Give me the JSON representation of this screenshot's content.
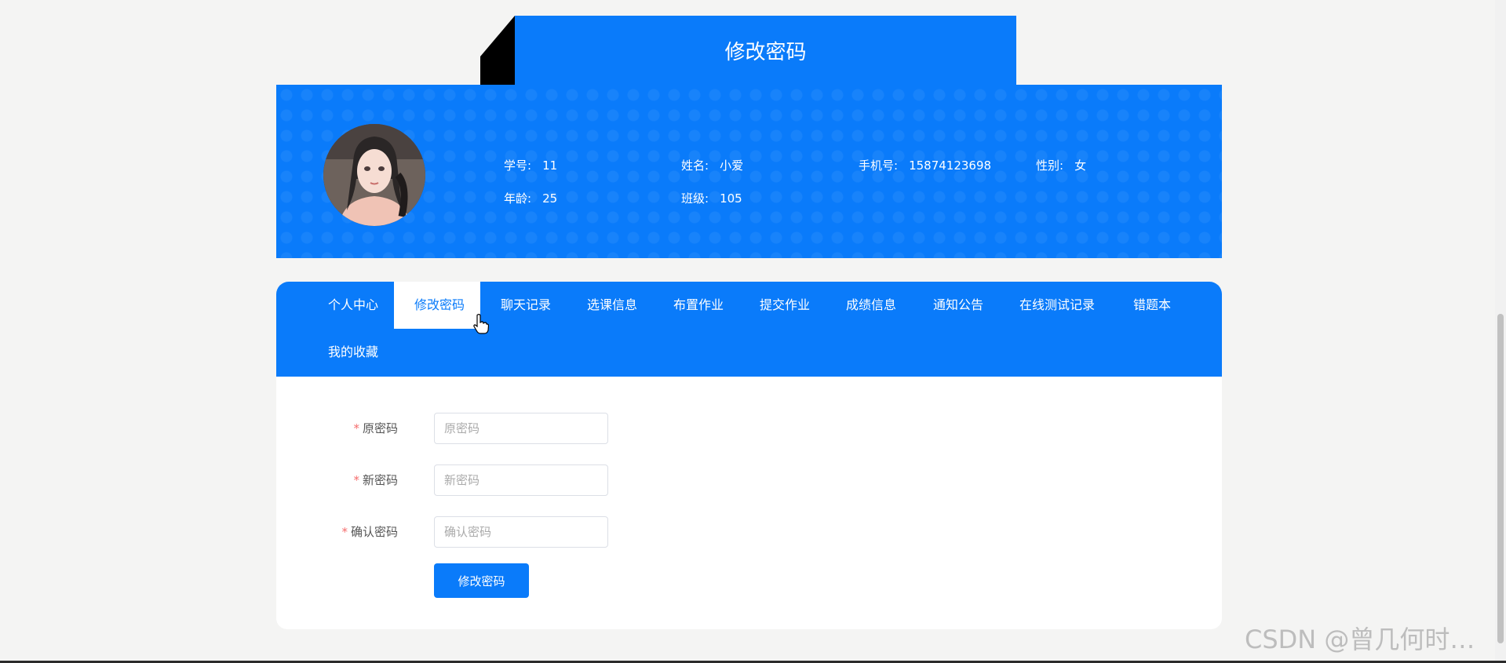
{
  "page": {
    "title": "修改密码"
  },
  "profile": {
    "fields": [
      {
        "label": "学号:",
        "value": "11"
      },
      {
        "label": "姓名:",
        "value": "小爱"
      },
      {
        "label": "手机号:",
        "value": "15874123698"
      },
      {
        "label": "性别:",
        "value": "女"
      },
      {
        "label": "年龄:",
        "value": "25"
      },
      {
        "label": "班级:",
        "value": "105"
      }
    ]
  },
  "tabs": [
    {
      "label": "个人中心"
    },
    {
      "label": "修改密码",
      "active": true
    },
    {
      "label": "聊天记录"
    },
    {
      "label": "选课信息"
    },
    {
      "label": "布置作业"
    },
    {
      "label": "提交作业"
    },
    {
      "label": "成绩信息"
    },
    {
      "label": "通知公告"
    },
    {
      "label": "在线测试记录"
    },
    {
      "label": "错题本"
    },
    {
      "label": "我的收藏"
    }
  ],
  "form": {
    "required_mark": "*",
    "fields": [
      {
        "label": "原密码",
        "placeholder": "原密码",
        "value": ""
      },
      {
        "label": "新密码",
        "placeholder": "新密码",
        "value": ""
      },
      {
        "label": "确认密码",
        "placeholder": "确认密码",
        "value": ""
      }
    ],
    "submit_label": "修改密码"
  },
  "watermark": "CSDN @曾几何时…",
  "colors": {
    "primary": "#0a7bfa",
    "required": "#f56c6c",
    "background": "#f4f4f3"
  }
}
